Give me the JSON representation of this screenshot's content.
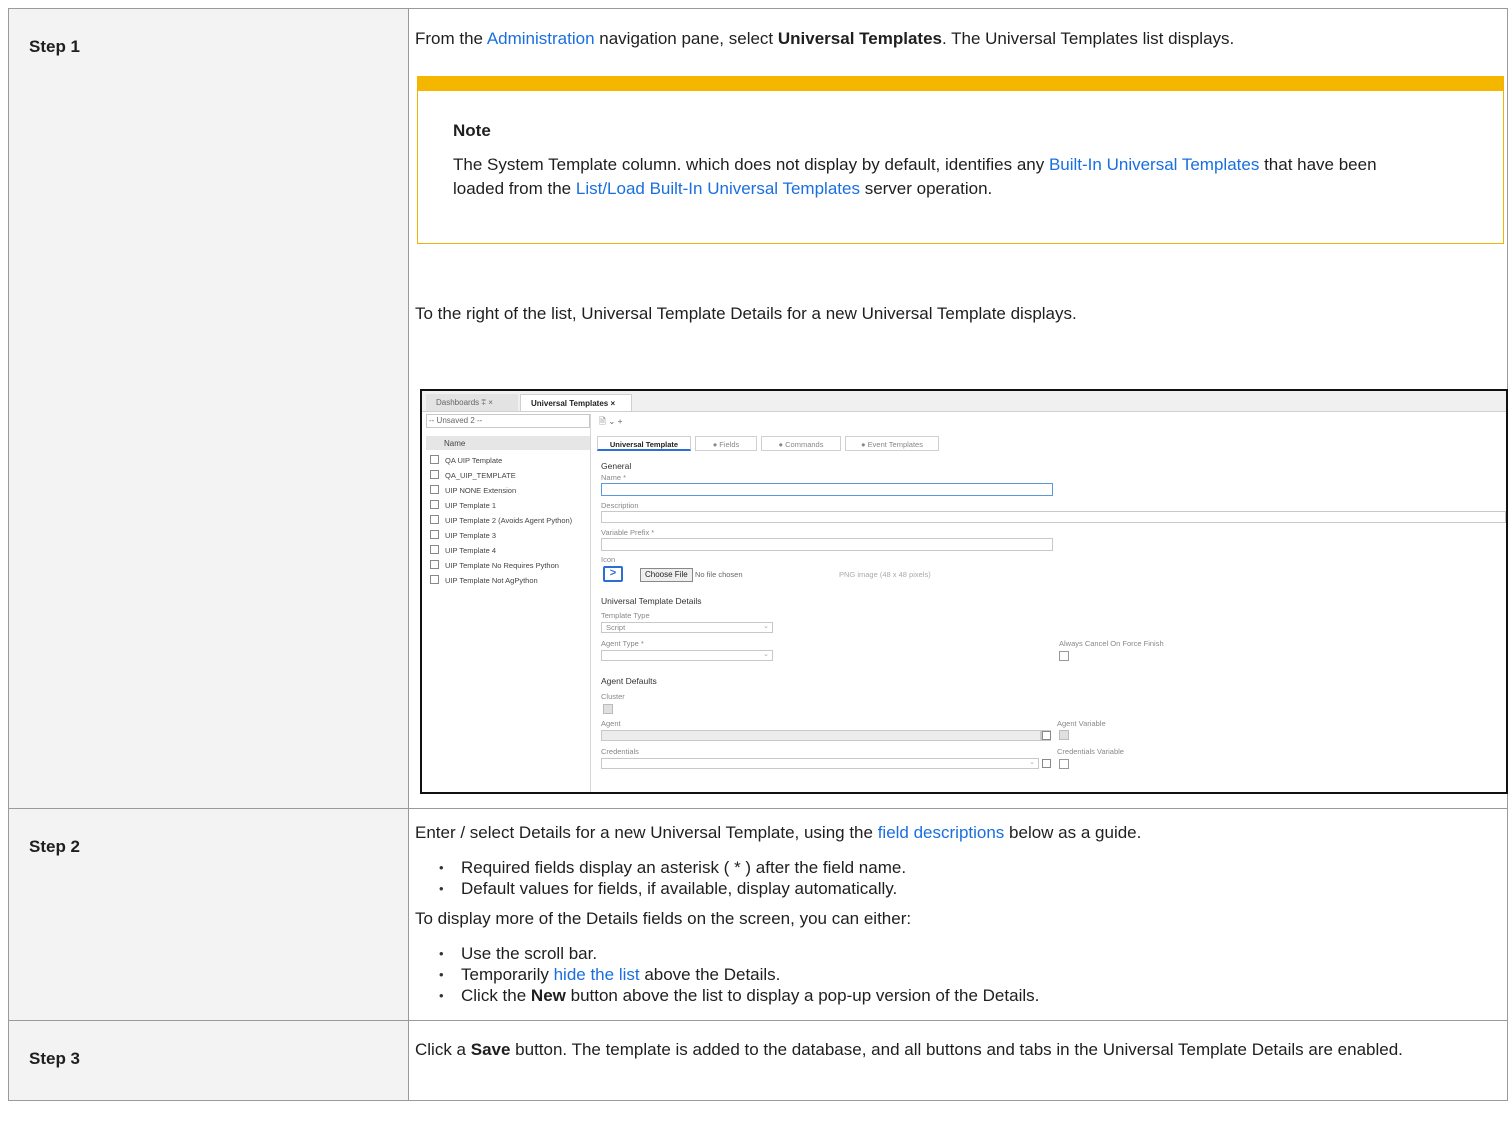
{
  "steps": [
    {
      "label": "Step 1",
      "intro": {
        "pre": "From the ",
        "link": "Administration",
        "mid": " navigation pane, select ",
        "bold": "Universal Templates",
        "post": ". The Universal Templates list displays."
      },
      "note": {
        "title": "Note",
        "pre": "The System Template column. which does not display by default, identifies any ",
        "link1": "Built-In Universal Templates",
        "mid": " that have been loaded from the ",
        "link2": "List/Load Built-In Universal Templates",
        "post": " server operation."
      },
      "after": "To the right of the list, Universal Template Details for a new Universal Template displays."
    },
    {
      "label": "Step 2",
      "intro": {
        "pre": "Enter / select Details for a new Universal Template, using the ",
        "link": "field descriptions",
        "post": " below as a guide."
      },
      "bullets1": [
        "Required fields display an asterisk ( * ) after the field name.",
        "Default values for fields, if available, display automatically."
      ],
      "middle": "To display more of the Details fields on the screen, you can either:",
      "bullets2": {
        "b1": "Use the scroll bar.",
        "b2_pre": "Temporarily ",
        "b2_link": "hide the list",
        "b2_post": " above the Details.",
        "b3_pre": "Click the ",
        "b3_bold": "New",
        "b3_post": " button above the list to display a pop-up version of the Details."
      }
    },
    {
      "label": "Step 3",
      "pre": "Click a ",
      "bold": "Save",
      "post": " button. The template is added to the database, and all buttons and tabs in the Universal Template Details are enabled."
    }
  ],
  "screenshot": {
    "tabs": [
      "Dashboards ⩱ ×",
      "Universal Templates ×"
    ],
    "filter_value": "-- Unsaved 2 --",
    "toolbar": "🗎 ⌄  +",
    "list_header": "Name",
    "list_items": [
      "QA UIP Template",
      "QA_UIP_TEMPLATE",
      "UIP NONE Extension",
      "UIP Template 1",
      "UIP Template 2 (Avoids Agent Python)",
      "UIP Template 3",
      "UIP Template 4",
      "UIP Template No Requires Python",
      "UIP Template Not AgPython"
    ],
    "detail_tabs": [
      "Universal Template",
      "● Fields",
      "● Commands",
      "● Event Templates"
    ],
    "general": "General",
    "name_label": "Name *",
    "description_label": "Description",
    "prefix_label": "Variable Prefix *",
    "icon_label": "Icon",
    "choose_file": "Choose File",
    "no_file": "No file chosen",
    "png_hint": "PNG image (48 x 48 pixels)",
    "details_section": "Universal Template Details",
    "template_type_label": "Template Type",
    "template_type_value": "Script",
    "agent_type_label": "Agent Type *",
    "always_cancel_label": "Always Cancel On Force Finish",
    "agent_defaults": "Agent Defaults",
    "cluster_label": "Cluster",
    "agent_label": "Agent",
    "agent_variable_label": "Agent Variable",
    "credentials_label": "Credentials",
    "credentials_variable_label": "Credentials Variable"
  }
}
